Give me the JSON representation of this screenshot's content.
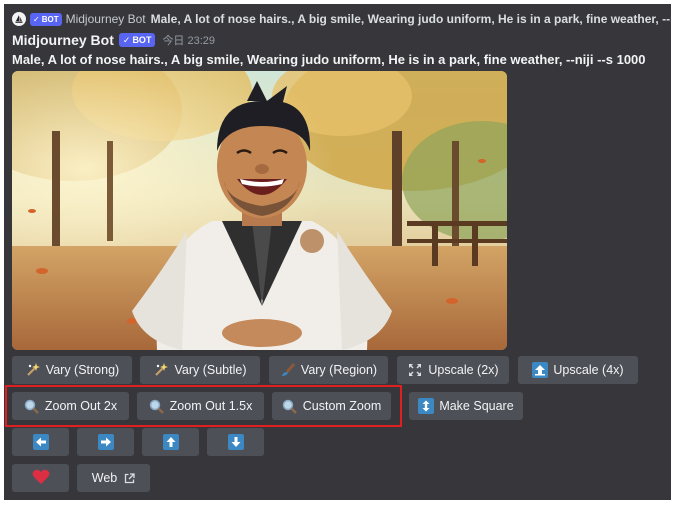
{
  "reply": {
    "bot_name": "Midjourney Bot",
    "badge": "BOT",
    "text": "Male, A lot of nose hairs., A big smile, Wearing judo uniform, He is in a park, fine weather, --niji"
  },
  "message": {
    "author": "Midjourney Bot",
    "badge": "BOT",
    "timestamp": "今日 23:29",
    "prompt": "Male, A lot of nose hairs., A big smile, Wearing judo uniform, He is in a park, fine weather, --niji --s 1000"
  },
  "buttons": {
    "row1": [
      "Vary (Strong)",
      "Vary (Subtle)",
      "Vary (Region)",
      "Upscale (2x)",
      "Upscale (4x)"
    ],
    "row2": [
      "Zoom Out 2x",
      "Zoom Out 1.5x",
      "Custom Zoom",
      "Make Square"
    ],
    "row4": {
      "web": "Web"
    }
  },
  "colors": {
    "background": "#37373b",
    "button": "#4e5058",
    "bot_badge": "#5865f2",
    "highlight_box": "#e02020",
    "emoji_blue": "#3b88c3"
  },
  "icons": {
    "vary_strong": "sparkles-icon",
    "vary_subtle": "sparkles-icon",
    "vary_region": "paintbrush-icon",
    "upscale_2x": "expand-arrows-icon",
    "upscale_4x": "up-arrow-box-icon",
    "zoom": "magnifier-icon",
    "make_square": "up-down-arrow-icon",
    "pans": [
      "left-arrow-icon",
      "right-arrow-icon",
      "up-arrow-icon",
      "down-arrow-icon"
    ],
    "favorite": "heart-icon",
    "external": "external-link-icon"
  }
}
